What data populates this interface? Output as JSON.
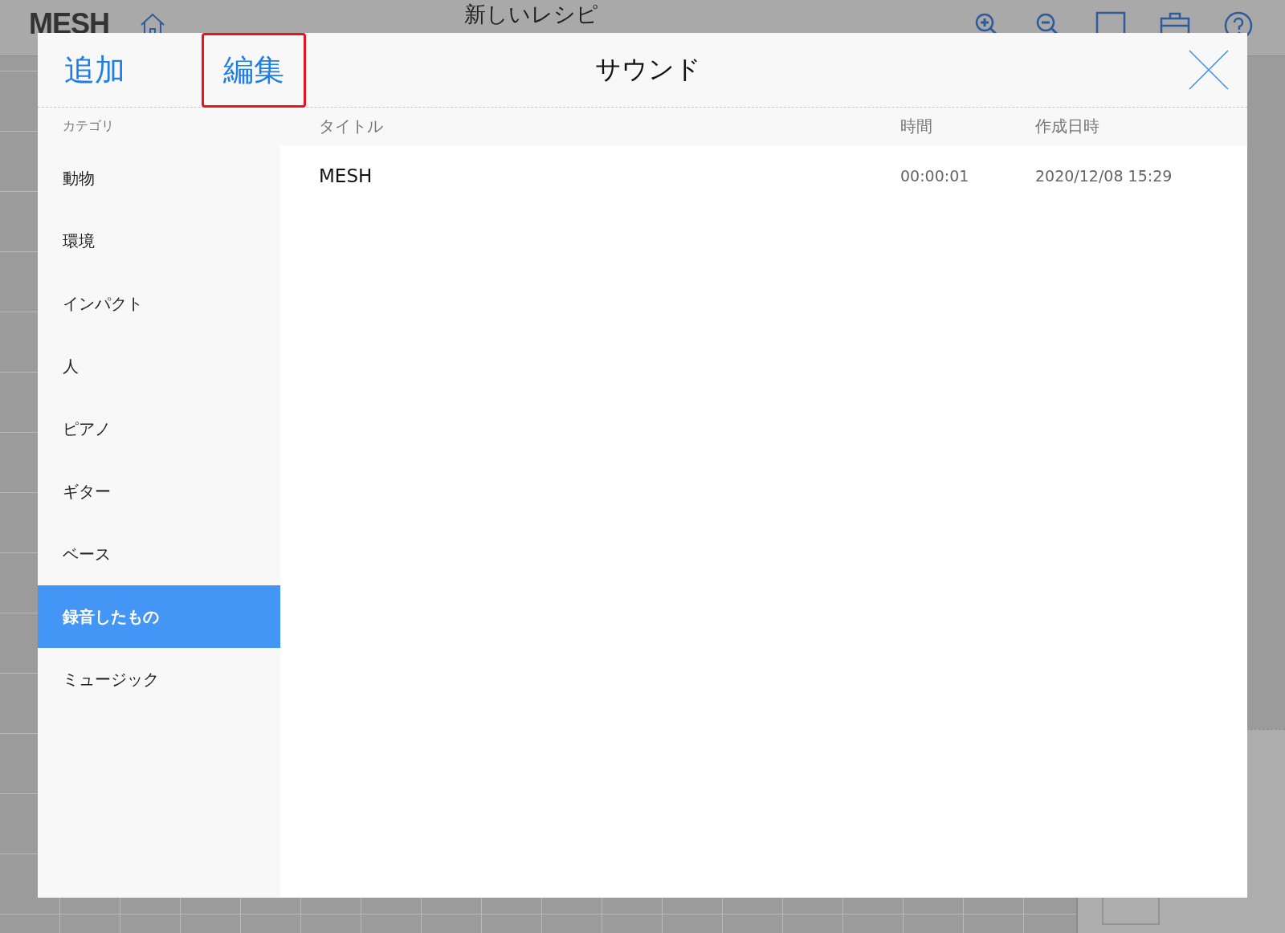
{
  "app_bar": {
    "logo": "MESH",
    "title": "新しいレシピ"
  },
  "dialog": {
    "title": "サウンド",
    "header_buttons": [
      {
        "label": "追加",
        "highlighted": false
      },
      {
        "label": "編集",
        "highlighted": true
      }
    ],
    "category_heading": "カテゴリ",
    "categories": [
      {
        "label": "動物",
        "selected": false
      },
      {
        "label": "環境",
        "selected": false
      },
      {
        "label": "インパクト",
        "selected": false
      },
      {
        "label": "人",
        "selected": false
      },
      {
        "label": "ピアノ",
        "selected": false
      },
      {
        "label": "ギター",
        "selected": false
      },
      {
        "label": "ベース",
        "selected": false
      },
      {
        "label": "録音したもの",
        "selected": true
      },
      {
        "label": "ミュージック",
        "selected": false
      }
    ],
    "table": {
      "columns": [
        "タイトル",
        "時間",
        "作成日時"
      ],
      "rows": [
        {
          "title": "MESH",
          "duration": "00:00:01",
          "created": "2020/12/08 15:29"
        }
      ]
    }
  }
}
